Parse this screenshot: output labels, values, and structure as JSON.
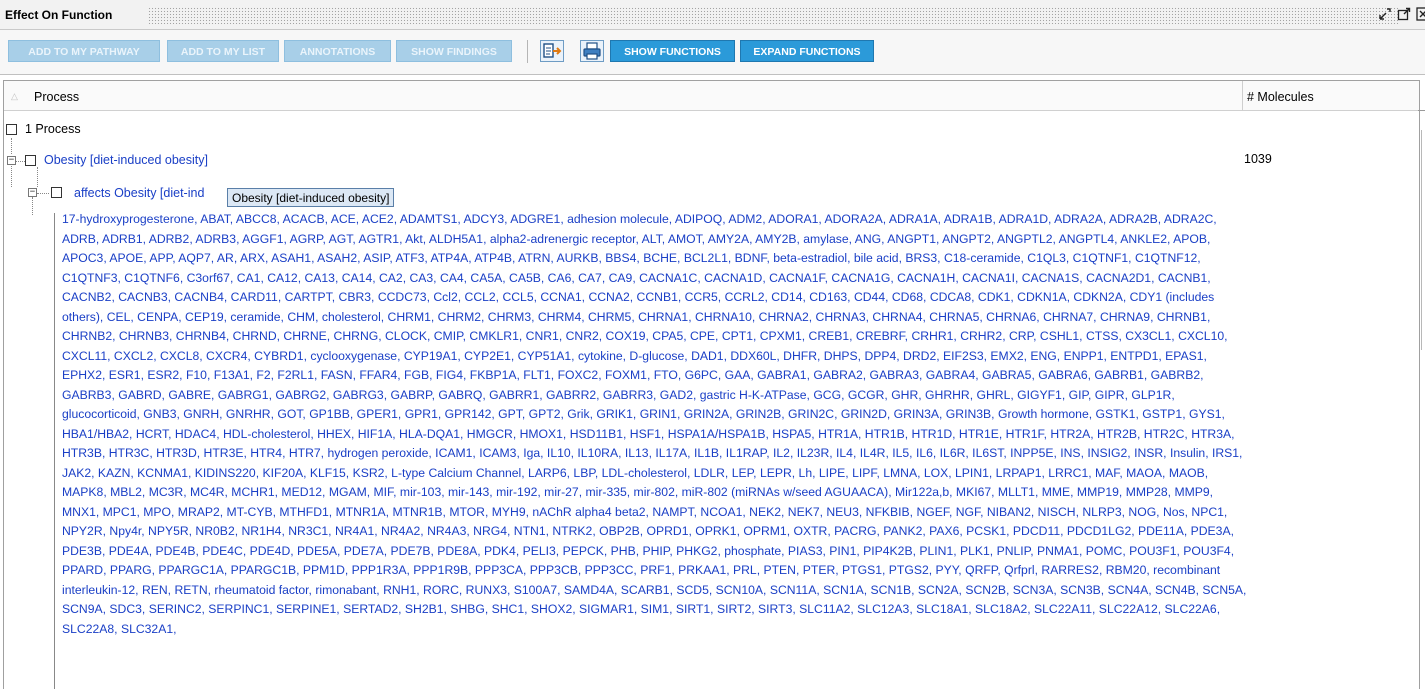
{
  "window": {
    "title": "Effect On Function",
    "icons": [
      "restore-icon",
      "popout-icon",
      "close-icon"
    ]
  },
  "toolbar": {
    "buttons": [
      {
        "label": "ADD TO MY PATHWAY",
        "enabled": false
      },
      {
        "label": "ADD TO MY LIST",
        "enabled": false
      },
      {
        "label": "ANNOTATIONS",
        "enabled": false
      },
      {
        "label": "SHOW FINDINGS",
        "enabled": false
      },
      {
        "label": "SHOW FUNCTIONS",
        "enabled": true
      },
      {
        "label": "EXPAND FUNCTIONS",
        "enabled": true
      }
    ],
    "icon_buttons": [
      "export-icon",
      "print-icon"
    ]
  },
  "grid": {
    "columns": [
      "Process",
      "# Molecules"
    ],
    "rows": [
      {
        "label": "1 Process",
        "count": ""
      },
      {
        "label": "Obesity [diet-induced obesity]",
        "count": "1039"
      },
      {
        "label": "affects Obesity [diet-ind",
        "count": ""
      }
    ],
    "tooltip": "Obesity [diet-induced obesity]",
    "molecules_text": "17-hydroxyprogesterone, ABAT, ABCC8, ACACB, ACE, ACE2, ADAMTS1, ADCY3, ADGRE1, adhesion molecule, ADIPOQ, ADM2, ADORA1, ADORA2A, ADRA1A, ADRA1B, ADRA1D, ADRA2A, ADRA2B, ADRA2C, ADRB, ADRB1, ADRB2, ADRB3, AGGF1, AGRP, AGT, AGTR1, Akt, ALDH5A1, alpha2-adrenergic receptor, ALT, AMOT, AMY2A, AMY2B, amylase, ANG, ANGPT1, ANGPT2, ANGPTL2, ANGPTL4, ANKLE2, APOB, APOC3, APOE, APP, AQP7, AR, ARX, ASAH1, ASAH2, ASIP, ATF3, ATP4A, ATP4B, ATRN, AURKB, BBS4, BCHE, BCL2L1, BDNF, beta-estradiol, bile acid, BRS3, C18-ceramide, C1QL3, C1QTNF1, C1QTNF12, C1QTNF3, C1QTNF6, C3orf67, CA1, CA12, CA13, CA14, CA2, CA3, CA4, CA5A, CA5B, CA6, CA7, CA9, CACNA1C, CACNA1D, CACNA1F, CACNA1G, CACNA1H, CACNA1I, CACNA1S, CACNA2D1, CACNB1, CACNB2, CACNB3, CACNB4, CARD11, CARTPT, CBR3, CCDC73, Ccl2, CCL2, CCL5, CCNA1, CCNA2, CCNB1, CCR5, CCRL2, CD14, CD163, CD44, CD68, CDCA8, CDK1, CDKN1A, CDKN2A, CDY1 (includes others), CEL, CENPA, CEP19, ceramide, CHM, cholesterol, CHRM1, CHRM2, CHRM3, CHRM4, CHRM5, CHRNA1, CHRNA10, CHRNA2, CHRNA3, CHRNA4, CHRNA5, CHRNA6, CHRNA7, CHRNA9, CHRNB1, CHRNB2, CHRNB3, CHRNB4, CHRND, CHRNE, CHRNG, CLOCK, CMIP, CMKLR1, CNR1, CNR2, COX19, CPA5, CPE, CPT1, CPXM1, CREB1, CREBRF, CRHR1, CRHR2, CRP, CSHL1, CTSS, CX3CL1, CXCL10, CXCL11, CXCL2, CXCL8, CXCR4, CYBRD1, cyclooxygenase, CYP19A1, CYP2E1, CYP51A1, cytokine, D-glucose, DAD1, DDX60L, DHFR, DHPS, DPP4, DRD2, EIF2S3, EMX2, ENG, ENPP1, ENTPD1, EPAS1, EPHX2, ESR1, ESR2, F10, F13A1, F2, F2RL1, FASN, FFAR4, FGB, FIG4, FKBP1A, FLT1, FOXC2, FOXM1, FTO, G6PC, GAA, GABRA1, GABRA2, GABRA3, GABRA4, GABRA5, GABRA6, GABRB1, GABRB2, GABRB3, GABRD, GABRE, GABRG1, GABRG2, GABRG3, GABRP, GABRQ, GABRR1, GABRR2, GABRR3, GAD2, gastric H-K-ATPase, GCG, GCGR, GHR, GHRHR, GHRL, GIGYF1, GIP, GIPR, GLP1R, glucocorticoid, GNB3, GNRH, GNRHR, GOT, GP1BB, GPER1, GPR1, GPR142, GPT, GPT2, Grik, GRIK1, GRIN1, GRIN2A, GRIN2B, GRIN2C, GRIN2D, GRIN3A, GRIN3B, Growth hormone, GSTK1, GSTP1, GYS1, HBA1/HBA2, HCRT, HDAC4, HDL-cholesterol, HHEX, HIF1A, HLA-DQA1, HMGCR, HMOX1, HSD11B1, HSF1, HSPA1A/HSPA1B, HSPA5, HTR1A, HTR1B, HTR1D, HTR1E, HTR1F, HTR2A, HTR2B, HTR2C, HTR3A, HTR3B, HTR3C, HTR3D, HTR3E, HTR4, HTR7, hydrogen peroxide, ICAM1, ICAM3, Iga, IL10, IL10RA, IL13, IL17A, IL1B, IL1RAP, IL2, IL23R, IL4, IL4R, IL5, IL6, IL6R, IL6ST, INPP5E, INS, INSIG2, INSR, Insulin, IRS1, JAK2, KAZN, KCNMA1, KIDINS220, KIF20A, KLF15, KSR2, L-type Calcium Channel, LARP6, LBP, LDL-cholesterol, LDLR, LEP, LEPR, Lh, LIPE, LIPF, LMNA, LOX, LPIN1, LRPAP1, LRRC1, MAF, MAOA, MAOB, MAPK8, MBL2, MC3R, MC4R, MCHR1, MED12, MGAM, MIF, mir-103, mir-143, mir-192, mir-27, mir-335, mir-802, miR-802 (miRNAs w/seed AGUAACA), Mir122a,b, MKI67, MLLT1, MME, MMP19, MMP28, MMP9, MNX1, MPC1, MPO, MRAP2, MT-CYB, MTHFD1, MTNR1A, MTNR1B, MTOR, MYH9, nAChR alpha4 beta2, NAMPT, NCOA1, NEK2, NEK7, NEU3, NFKBIB, NGEF, NGF, NIBAN2, NISCH, NLRP3, NOG, Nos, NPC1, NPY2R, Npy4r, NPY5R, NR0B2, NR1H4, NR3C1, NR4A1, NR4A2, NR4A3, NRG4, NTN1, NTRK2, OBP2B, OPRD1, OPRK1, OPRM1, OXTR, PACRG, PANK2, PAX6, PCSK1, PDCD11, PDCD1LG2, PDE11A, PDE3A, PDE3B, PDE4A, PDE4B, PDE4C, PDE4D, PDE5A, PDE7A, PDE7B, PDE8A, PDK4, PELI3, PEPCK, PHB, PHIP, PHKG2, phosphate, PIAS3, PIN1, PIP4K2B, PLIN1, PLK1, PNLIP, PNMA1, POMC, POU3F1, POU3F4, PPARD, PPARG, PPARGC1A, PPARGC1B, PPM1D, PPP1R3A, PPP1R9B, PPP3CA, PPP3CB, PPP3CC, PRF1, PRKAA1, PRL, PTEN, PTER, PTGS1, PTGS2, PYY, QRFP, Qrfprl, RARRES2, RBM20, recombinant interleukin-12, REN, RETN, rheumatoid factor, rimonabant, RNH1, RORC, RUNX3, S100A7, SAMD4A, SCARB1, SCD5, SCN10A, SCN11A, SCN1A, SCN1B, SCN2A, SCN2B, SCN3A, SCN3B, SCN4A, SCN4B, SCN5A, SCN9A, SDC3, SERINC2, SERPINC1, SERPINE1, SERTAD2, SH2B1, SHBG, SHC1, SHOX2, SIGMAR1, SIM1, SIRT1, SIRT2, SIRT3, SLC11A2, SLC12A3, SLC18A1, SLC18A2, SLC22A11, SLC22A12, SLC22A6, SLC22A8, SLC32A1,"
  }
}
